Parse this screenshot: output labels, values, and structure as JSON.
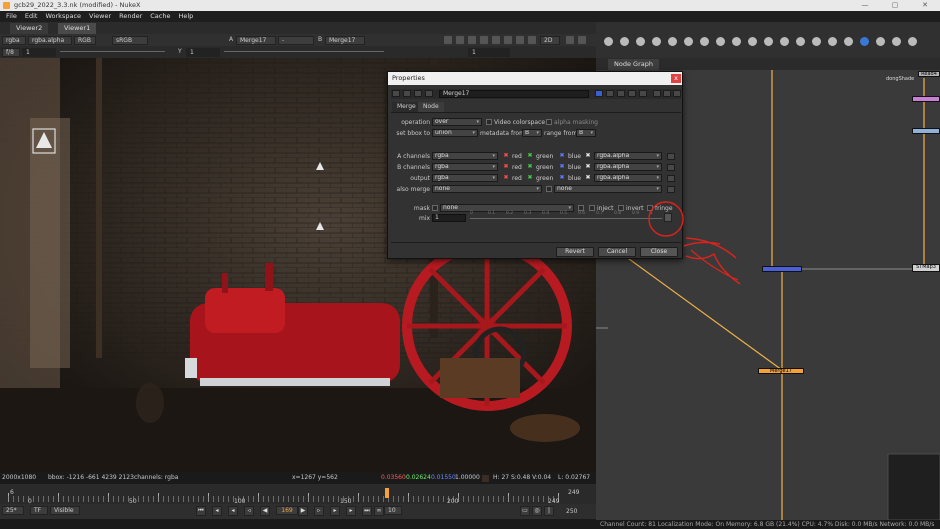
{
  "window": {
    "title": "gcb29_2022_3.3.nk (modified) - NukeX"
  },
  "menubar": [
    "File",
    "Edit",
    "Workspace",
    "Viewer",
    "Render",
    "Cache",
    "Help"
  ],
  "viewer": {
    "tabs": [
      "Viewer2",
      "Viewer1"
    ],
    "channels": "rgba",
    "alpha": "rgba.alpha",
    "colorspace_channels": "RGB",
    "lut": "sRGB",
    "input_a": "Merge17",
    "input_a_prefix": "A",
    "input_b_prefix": "B",
    "input_b": "Merge17",
    "wipe": "-",
    "mode": "2D",
    "fstop": "f/8",
    "gain_value": "1",
    "gamma_label": "Y",
    "gamma_value": "1",
    "ctrl2_value": "1",
    "info": {
      "format": "2000x1080",
      "bbox": "bbox: -1216 -661 4239 2123",
      "channels": "channels: rgba",
      "coords": "x=1267 y=562",
      "r": "0.03560",
      "g": "0.02624",
      "b": "0.01550",
      "a": "1.00000",
      "hsv": "H: 27 S:0.48 V:0.04",
      "l": "L: 0.02767"
    }
  },
  "timeline": {
    "start": "6",
    "end": "249",
    "end_display": "249",
    "current_frame": "169",
    "ticks": [
      "0",
      "50",
      "100",
      "150",
      "200",
      "249"
    ],
    "fps": "25*",
    "tf": "TF",
    "visible": "Visible",
    "step": "10",
    "out_frame": "250"
  },
  "node_graph": {
    "tab": "Node Graph",
    "nodes": [
      "Read4",
      "Merge17",
      "STMap3"
    ],
    "partial_label": "dongShade"
  },
  "properties": {
    "title": "Properties",
    "node_name": "Merge17",
    "tabs": [
      "Merge",
      "Node"
    ],
    "operation_label": "operation",
    "operation": "over",
    "video_colorspace": "Video colorspace",
    "alpha_masking": "alpha masking",
    "set_bbox_label": "set bbox to",
    "set_bbox": "union",
    "metadata_label": "metadata from",
    "metadata": "B",
    "range_label": "range from",
    "range": "B",
    "a_channels_label": "A channels",
    "b_channels_label": "B channels",
    "output_label": "output",
    "also_merge_label": "also merge",
    "channel_value": "rgba",
    "alpha_value": "rgba.alpha",
    "also_merge": "none",
    "also_merge_2": "none",
    "red": "red",
    "green": "green",
    "blue": "blue",
    "mask_label": "mask",
    "mask": "none",
    "inject": "inject",
    "invert": "invert",
    "fringe": "fringe",
    "mix_label": "mix",
    "mix": "1",
    "mix_ticks": [
      "0",
      "0.1",
      "0.2",
      "0.3",
      "0.4",
      "0.5",
      "0.6",
      "0.7",
      "0.8",
      "0.9",
      "1"
    ],
    "buttons": {
      "revert": "Revert",
      "cancel": "Cancel",
      "close": "Close"
    },
    "close_x": "x"
  },
  "status": "Channel Count: 81  Localization Mode: On  Memory: 6.8 GB (21.4%)  CPU: 4.7%  Disk: 0.0 MB/s  Network: 0.0 MB/s",
  "colors": {
    "nuke_orange": "#f4a13a",
    "merge_node": "#4b5fd6",
    "annotation_red": "#e0221c",
    "close_red": "#e04141"
  }
}
